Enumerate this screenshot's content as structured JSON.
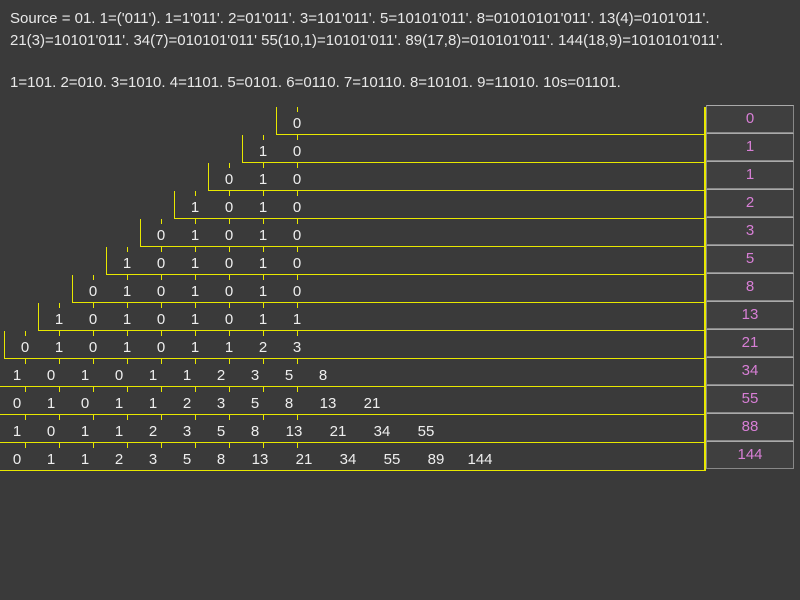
{
  "header_line1": "Source = 01. 1=('011'). 1=1'011'. 2=01'011'. 3=101'011'. 5=10101'011'. 8=01010101'011'. 13(4)=0101'011'. 21(3)=10101'011'. 34(7)=010101'011' 55(10,1)=10101'011'. 89(17,8)=010101'011'. 144(18,9)=1010101'011'.",
  "header_line2": "1=101. 2=010. 3=1010. 4=1101. 5=0101. 6=0110. 7=10110. 8=10101. 9=11010.  10s=01101.",
  "chart_data": {
    "type": "table",
    "title": "Fibonacci binary triangle",
    "rows": [
      [
        "0"
      ],
      [
        "1",
        "0"
      ],
      [
        "0",
        "1",
        "0"
      ],
      [
        "1",
        "0",
        "1",
        "0"
      ],
      [
        "0",
        "1",
        "0",
        "1",
        "0"
      ],
      [
        "1",
        "0",
        "1",
        "0",
        "1",
        "0"
      ],
      [
        "0",
        "1",
        "0",
        "1",
        "0",
        "1",
        "0"
      ],
      [
        "1",
        "0",
        "1",
        "0",
        "1",
        "0",
        "1",
        "1"
      ],
      [
        "0",
        "1",
        "0",
        "1",
        "0",
        "1",
        "1",
        "2",
        "3"
      ],
      [
        "1",
        "0",
        "1",
        "0",
        "1",
        "1",
        "2",
        "3",
        "5",
        "8"
      ],
      [
        "0",
        "1",
        "0",
        "1",
        "1",
        "2",
        "3",
        "5",
        "8",
        "13",
        "21"
      ],
      [
        "1",
        "0",
        "1",
        "1",
        "2",
        "3",
        "5",
        "8",
        "13",
        "21",
        "34",
        "55"
      ],
      [
        "0",
        "1",
        "1",
        "2",
        "3",
        "5",
        "8",
        "13",
        "21",
        "34",
        "55",
        "89",
        "144"
      ]
    ],
    "sidebar": [
      "0",
      "1",
      "1",
      "2",
      "3",
      "5",
      "8",
      "13",
      "21",
      "34",
      "55",
      "88",
      "144"
    ]
  },
  "colors": {
    "accent": "#e8e800",
    "sidebar_text": "#d87fd6",
    "bg": "#3a3a3a"
  }
}
